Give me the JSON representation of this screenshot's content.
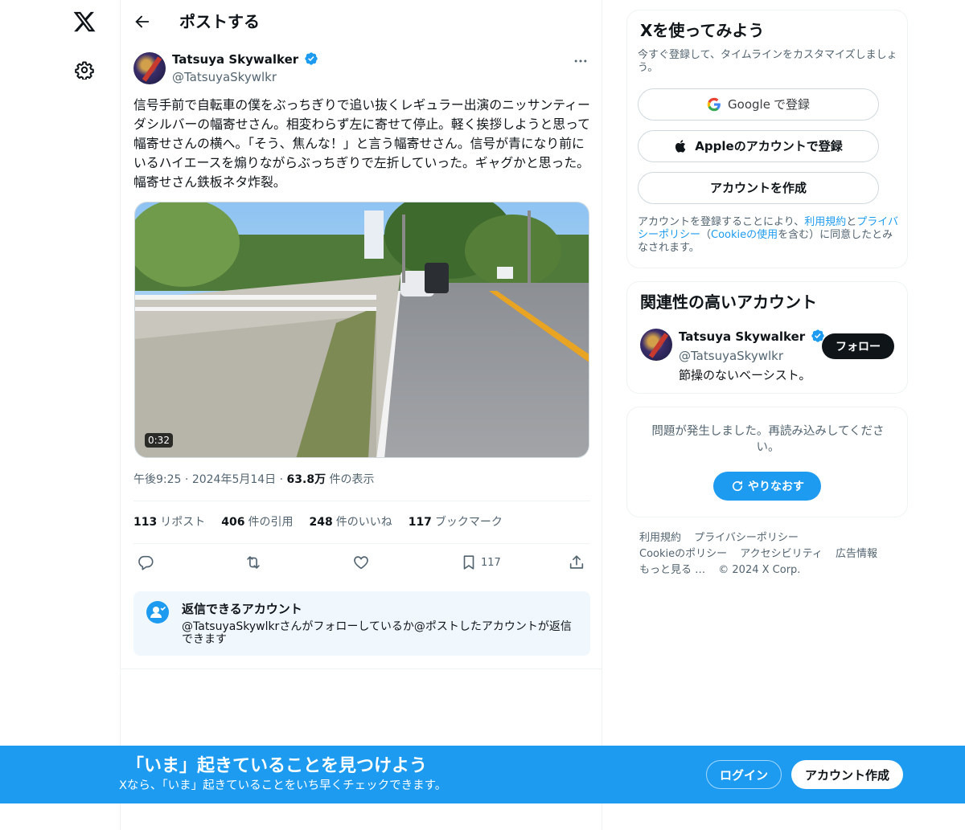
{
  "header": {
    "title": "ポストする"
  },
  "tweet": {
    "author_name": "Tatsuya Skywalker",
    "author_handle": "@TatsuyaSkywlkr",
    "text": "信号手前で自転車の僕をぶっちぎりで追い抜くレギュラー出演のニッサンティーダシルバーの幅寄せさん。相変わらず左に寄せて停止。軽く挨拶しようと思って幅寄せさんの横へ。「そう、焦んな！」と言う幅寄せさん。信号が青になり前にいるハイエースを煽りながらぶっちぎりで左折していった。ギャグかと思った。幅寄せさん鉄板ネタ炸裂。",
    "video_duration": "0:32",
    "time": "午後9:25",
    "date": "2024年5月14日",
    "views_count": "63.8万",
    "views_label": "件の表示",
    "separator": "·",
    "stats": {
      "reposts_count": "113",
      "reposts_label": "リポスト",
      "quotes_count": "406",
      "quotes_label": "件の引用",
      "likes_count": "248",
      "likes_label": "件のいいね",
      "bookmarks_count": "117",
      "bookmarks_label": "ブックマーク"
    },
    "bookmark_action_count": "117"
  },
  "reply_restriction": {
    "title": "返信できるアカウント",
    "description": "@TatsuyaSkywlkrさんがフォローしているか@ポストしたアカウントが返信できます"
  },
  "signup_card": {
    "title": "Xを使ってみよう",
    "subtitle": "今すぐ登録して、タイムラインをカスタマイズしましょう。",
    "google_label_brand": "Google",
    "google_label_suffix": "で登録",
    "apple_label": "Appleのアカウントで登録",
    "create_label": "アカウントを作成",
    "legal_prefix": "アカウントを登録することにより、",
    "legal_terms": "利用規約",
    "legal_and": "と",
    "legal_privacy": "プライバシーポリシー",
    "legal_paren_open": "（",
    "legal_cookie": "Cookieの使用",
    "legal_suffix": "を含む）に同意したとみなされます。"
  },
  "relevant_accounts": {
    "title": "関連性の高いアカウント",
    "name": "Tatsuya Skywalker",
    "handle": "@TatsuyaSkywlkr",
    "bio": "節操のないベーシスト。",
    "follow_label": "フォロー"
  },
  "error_card": {
    "message": "問題が発生しました。再読み込みしてください。",
    "retry_label": "やりなおす"
  },
  "footer": {
    "links": [
      "利用規約",
      "プライバシーポリシー",
      "Cookieのポリシー",
      "アクセシビリティ",
      "広告情報",
      "もっと見る …"
    ],
    "copyright": "© 2024 X Corp."
  },
  "banner": {
    "title": "「いま」起きていることを見つけよう",
    "subtitle": "Xなら、「いま」起きていることをいち早くチェックできます。",
    "login_label": "ログイン",
    "signup_label": "アカウント作成"
  },
  "colors": {
    "accent": "#1d9bf0",
    "text": "#0f1419",
    "muted": "#536471"
  }
}
